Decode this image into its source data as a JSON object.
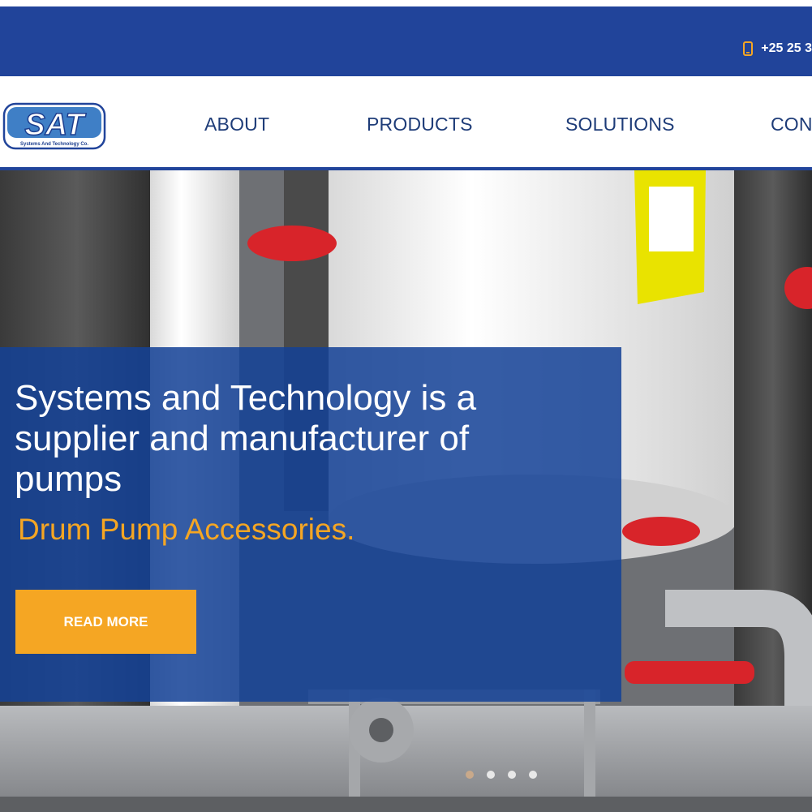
{
  "topbar": {
    "phone_icon": "mobile-phone-icon",
    "phone": "+25 25 3"
  },
  "header": {
    "logo": {
      "text": "SAT",
      "tagline": "Systems And Technology Co."
    },
    "nav": [
      {
        "label": "ABOUT"
      },
      {
        "label": "PRODUCTS"
      },
      {
        "label": "SOLUTIONS"
      },
      {
        "label": "CON"
      }
    ]
  },
  "hero": {
    "title": "Systems and Technology is a supplier and manufacturer of pumps",
    "subtitle": "Drum Pump Accessories.",
    "button_label": "READ MORE",
    "slides": {
      "count": 4,
      "active": 1
    }
  },
  "colors": {
    "brand_blue": "#21449a",
    "accent_orange": "#f5a623",
    "nav_text": "#1e3c78"
  }
}
